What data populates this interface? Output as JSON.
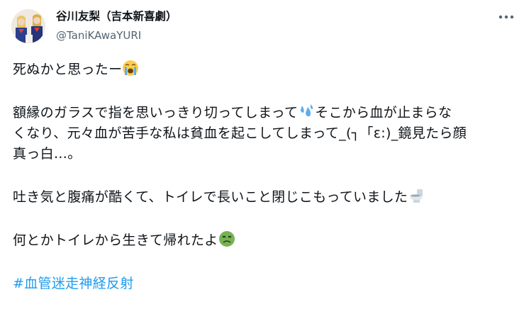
{
  "author": {
    "display_name": "谷川友梨（吉本新喜劇）",
    "handle": "@TaniKAwaYURI",
    "avatar_icon": "profile-avatar"
  },
  "more_icon": "more-horizontal-icon",
  "tweet": {
    "line1": "死ぬかと思ったー",
    "para2_a": "額縁のガラスで指を思いっきり切ってしまって",
    "para2_b": "そこから血が止まらな",
    "para2_line2": "くなり、元々血が苦手な私は貧血を起こしてしまって_(┐「ε:)_鏡見たら顔",
    "para2_line3": "真っ白…。",
    "para3": "吐き気と腹痛が酷くて、トイレで長いこと閉じこもっていました",
    "para4": "何とかトイレから生きて帰れたよ",
    "hashtag": "#血管迷走神経反射"
  },
  "emojis": {
    "crying": "loudly-crying-face-icon",
    "sweat": "sweat-droplets-icon",
    "toilet": "toilet-icon",
    "nauseated": "nauseated-face-icon"
  },
  "colors": {
    "link": "#1d9bf0",
    "secondary": "#536471",
    "text": "#0f1419"
  }
}
